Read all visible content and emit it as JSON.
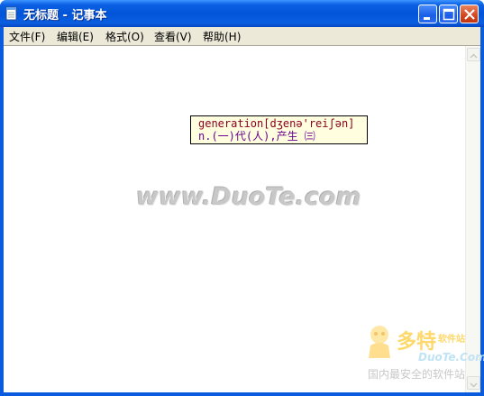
{
  "window": {
    "title": "无标题 - 记事本",
    "buttons": {
      "minimize": "minimize-icon",
      "maximize": "maximize-icon",
      "close": "close-icon"
    }
  },
  "menubar": {
    "items": [
      {
        "label": "文件(F)"
      },
      {
        "label": "编辑(E)"
      },
      {
        "label": "格式(O)"
      },
      {
        "label": "查看(V)"
      },
      {
        "label": "帮助(H)"
      }
    ]
  },
  "tooltip": {
    "line1": "generation[dʒenə'reiʃən]",
    "line2": "n.(一)代(人),产生 ㈢"
  },
  "watermark": {
    "text": "www.DuoTe.com"
  },
  "site_logo": {
    "name": "多特",
    "sub": "软件站",
    "domain": "DuoTe.Com",
    "tagline": "国内最安全的软件站"
  },
  "colors": {
    "titlebar": "#0255d9",
    "menubar": "#ece9d8",
    "tooltip_bg": "#ffffe0"
  }
}
